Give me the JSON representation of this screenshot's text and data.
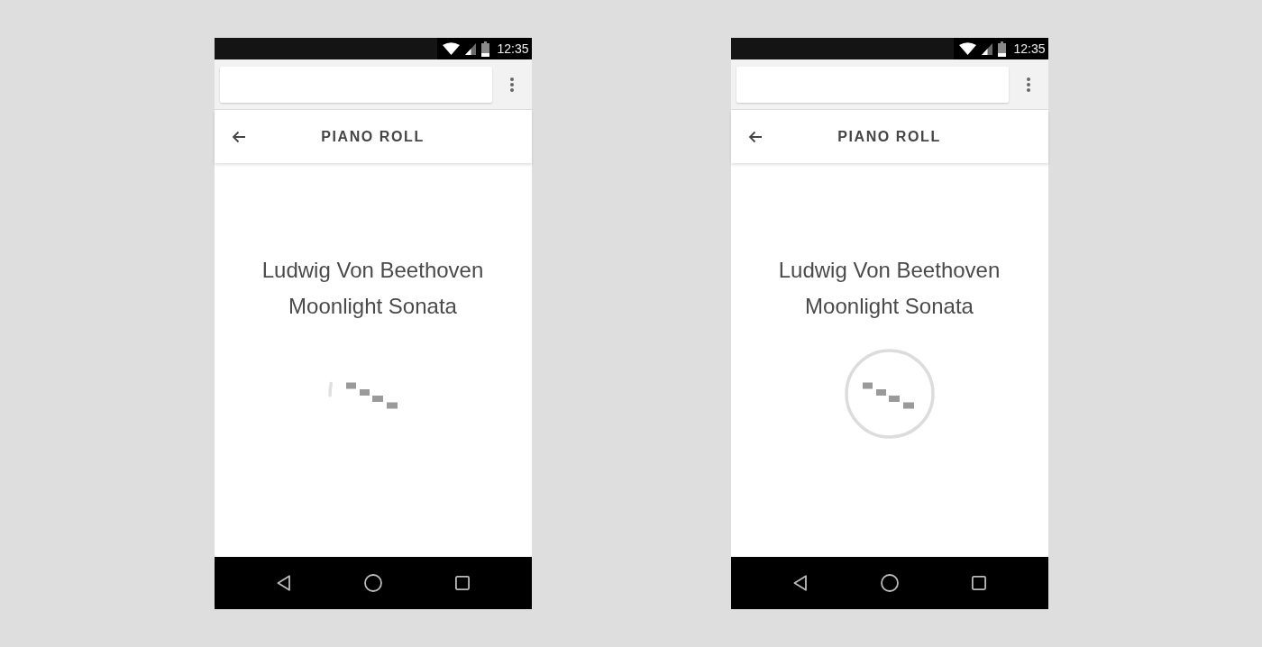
{
  "phones": [
    {
      "status_bar": {
        "time": "12:35"
      },
      "header": {
        "title": "PIANO ROLL"
      },
      "composer": "Ludwig Von Beethoven",
      "piece": "Moonlight Sonata",
      "loader": {
        "kind": "arc"
      }
    },
    {
      "status_bar": {
        "time": "12:35"
      },
      "header": {
        "title": "PIANO ROLL"
      },
      "composer": "Ludwig Von Beethoven",
      "piece": "Moonlight Sonata",
      "loader": {
        "kind": "ring"
      }
    }
  ]
}
